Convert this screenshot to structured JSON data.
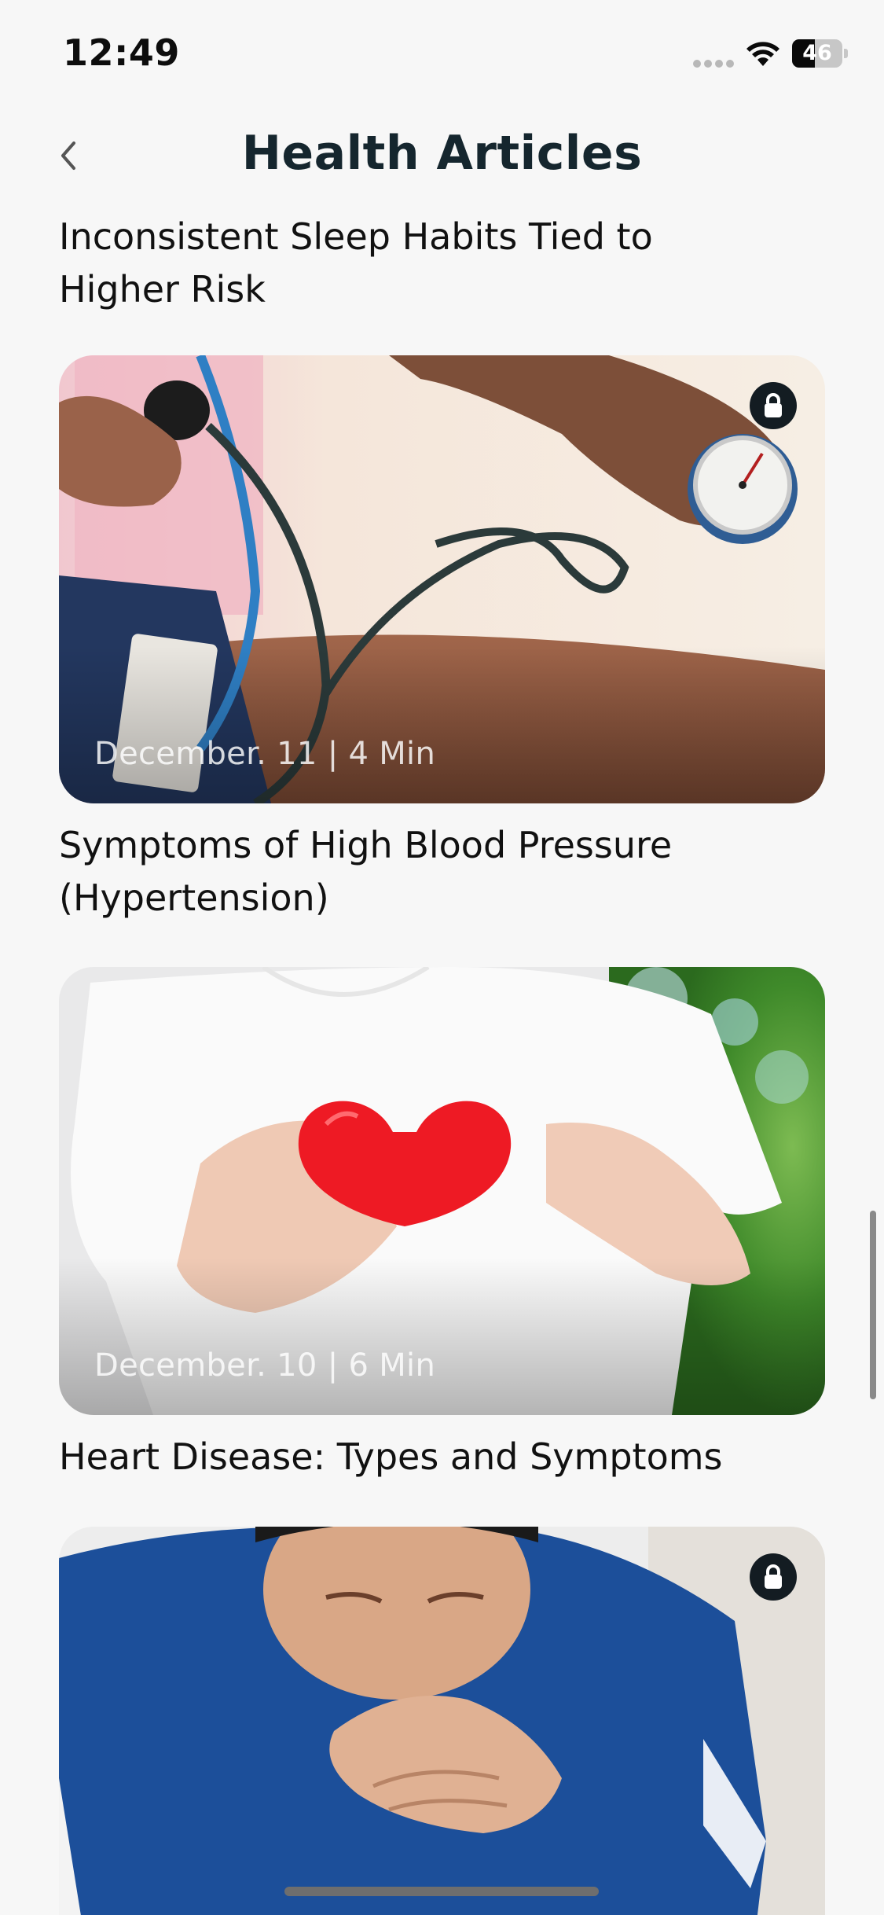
{
  "status_bar": {
    "time": "12:49",
    "battery_level": "46",
    "battery_fraction": 0.46,
    "signal_icon": "signal-dots-icon",
    "wifi_icon": "wifi-icon"
  },
  "header": {
    "title": "Health Articles",
    "back_icon": "chevron-left-icon"
  },
  "articles": [
    {
      "title": "Inconsistent Sleep Habits Tied to Higher Risk",
      "partially_visible": true
    },
    {
      "meta": "December. 11 | 4 Min",
      "title": "Symptoms of High Blood Pressure (Hypertension)",
      "locked": true,
      "image": "blood-pressure-cuff-photo"
    },
    {
      "meta": "December. 10 | 6 Min",
      "title": "Heart Disease: Types and Symptoms",
      "locked": false,
      "image": "hands-holding-red-heart-photo"
    },
    {
      "meta": "",
      "title": "",
      "locked": true,
      "image": "man-clutching-chest-photo"
    }
  ],
  "colors": {
    "background": "#f7f7f7",
    "title": "#15262e",
    "lock_badge": "#131c22"
  }
}
